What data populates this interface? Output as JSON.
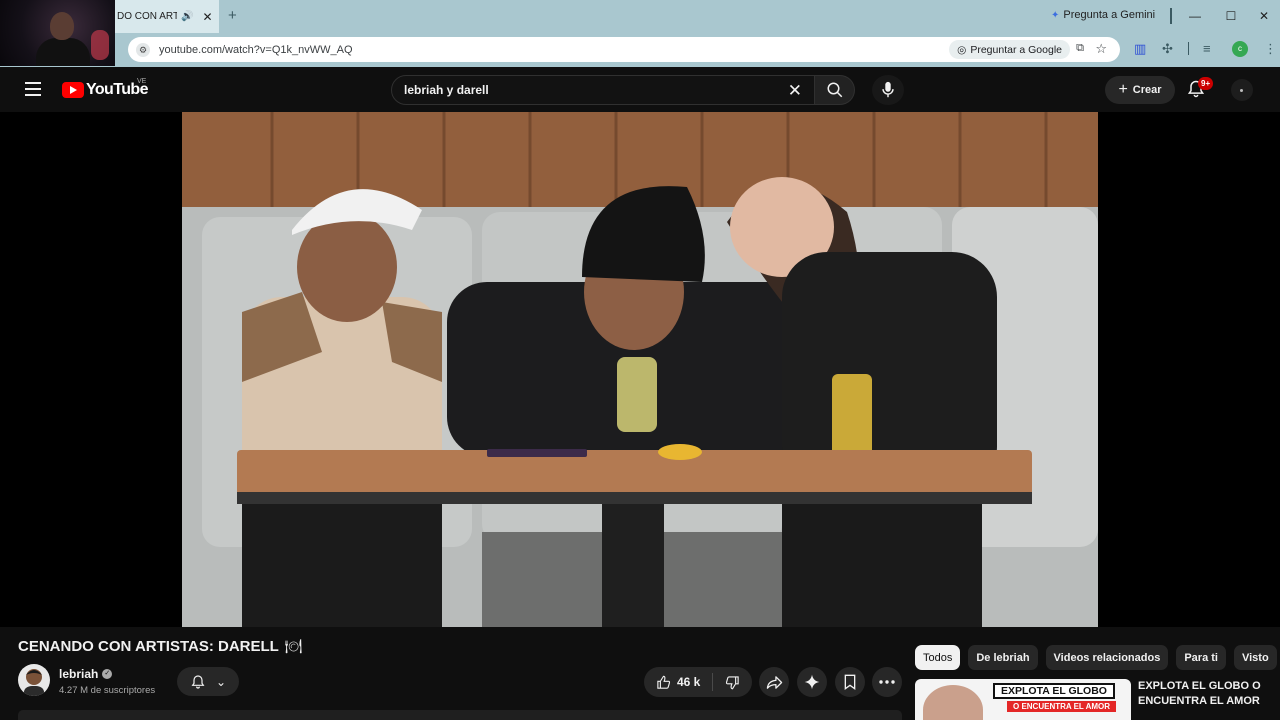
{
  "browser": {
    "tab": {
      "title": "DO CON ARTI"
    },
    "gemini_label": "Pregunta a Gemini",
    "url": "youtube.com/watch?v=Q1k_nvWW_AQ",
    "ask_google_label": "Preguntar a Google",
    "profile_initial": "c"
  },
  "header": {
    "logo_text": "YouTube",
    "country_code": "VE",
    "search_query": "lebriah y darell",
    "create_label": "Crear",
    "notifications_badge": "9+"
  },
  "video": {
    "title": "CENANDO CON ARTISTAS: DARELL",
    "title_emoji": "🍽",
    "channel": {
      "name": "lebriah",
      "subscribers": "4.27 M de suscriptores"
    },
    "likes": "46 k"
  },
  "related": {
    "chips": [
      "Todos",
      "De lebriah",
      "Videos relacionados",
      "Para ti",
      "Visto"
    ],
    "first_video": {
      "title": "EXPLOTA EL GLOBO O ENCUENTRA EL AMOR",
      "thumb_text_1": "EXPLOTA EL GLOBO",
      "thumb_text_2": "O ENCUENTRA EL AMOR"
    }
  },
  "colors": {
    "chrome_frame": "#a9c7cf",
    "yt_background": "#0f0f0f",
    "yt_red": "#ff0000",
    "chip_bg": "#272727",
    "notif_badge": "#cc0000"
  },
  "icons": [
    "menu-icon",
    "youtube-logo-icon",
    "clear-icon",
    "search-icon",
    "mic-icon",
    "plus-icon",
    "bell-icon",
    "verified-icon",
    "bell-ring-icon",
    "chevron-down-icon",
    "like-icon",
    "dislike-icon",
    "share-icon",
    "sparkle-icon",
    "bookmark-icon",
    "more-icon"
  ]
}
